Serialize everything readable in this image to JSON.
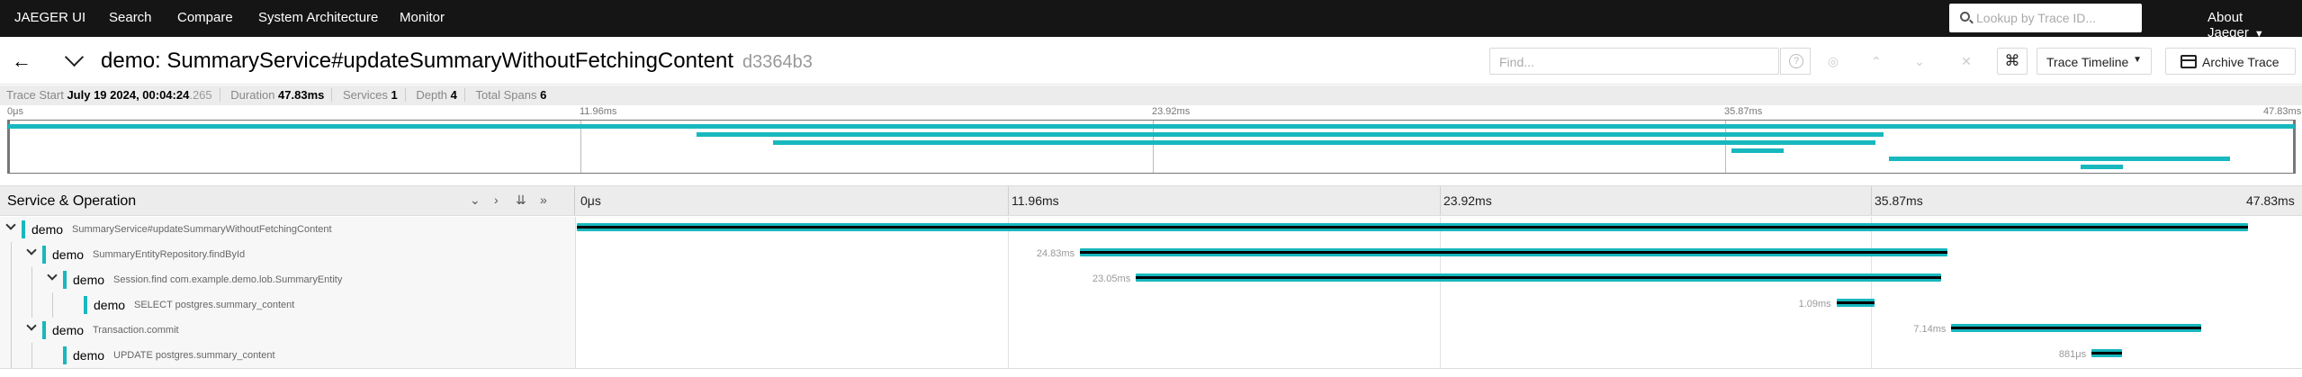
{
  "topnav": {
    "brand": "JAEGER UI",
    "items": [
      "Search",
      "Compare",
      "System Architecture",
      "Monitor"
    ],
    "lookup_placeholder": "Lookup by Trace ID...",
    "about": "About Jaeger"
  },
  "title": {
    "text": "demo: SummaryService#updateSummaryWithoutFetchingContent",
    "trace_id": "d3364b3",
    "find_placeholder": "Find...",
    "view_label": "Trace Timeline",
    "archive_label": "Archive Trace"
  },
  "meta": {
    "trace_start_label": "Trace Start",
    "trace_start_value": "July 19 2024, 00:04:24",
    "trace_start_ms": ".265",
    "duration_label": "Duration",
    "duration_value": "47.83ms",
    "services_label": "Services",
    "services_value": "1",
    "depth_label": "Depth",
    "depth_value": "4",
    "total_spans_label": "Total Spans",
    "total_spans_value": "6"
  },
  "minimap_ticks": [
    "0μs",
    "11.96ms",
    "23.92ms",
    "35.87ms",
    "47.83ms"
  ],
  "header": {
    "title": "Service & Operation",
    "ticks": [
      "0μs",
      "11.96ms",
      "23.92ms",
      "35.87ms",
      "47.83ms"
    ]
  },
  "spans": [
    {
      "service": "demo",
      "operation": "SummaryService#updateSummaryWithoutFetchingContent",
      "duration_label": "",
      "depth": 0,
      "start_ms": 0.0,
      "duration_ms": 47.83,
      "has_children": true
    },
    {
      "service": "demo",
      "operation": "SummaryEntityRepository.findById",
      "duration_label": "24.83ms",
      "depth": 1,
      "start_ms": 14.4,
      "duration_ms": 24.83,
      "has_children": true
    },
    {
      "service": "demo",
      "operation": "Session.find com.example.demo.lob.SummaryEntity",
      "duration_label": "23.05ms",
      "depth": 2,
      "start_ms": 16.0,
      "duration_ms": 23.05,
      "has_children": true
    },
    {
      "service": "demo",
      "operation": "SELECT postgres.summary_content",
      "duration_label": "1.09ms",
      "depth": 3,
      "start_ms": 36.05,
      "duration_ms": 1.09,
      "has_children": false
    },
    {
      "service": "demo",
      "operation": "Transaction.commit",
      "duration_label": "7.14ms",
      "depth": 1,
      "start_ms": 39.34,
      "duration_ms": 7.14,
      "has_children": true
    },
    {
      "service": "demo",
      "operation": "UPDATE postgres.summary_content",
      "duration_label": "881μs",
      "depth": 2,
      "start_ms": 43.35,
      "duration_ms": 0.881,
      "has_children": false
    }
  ],
  "total_ms": 47.83,
  "colors": {
    "span": "#17b8be",
    "nav_bg": "#151515"
  }
}
